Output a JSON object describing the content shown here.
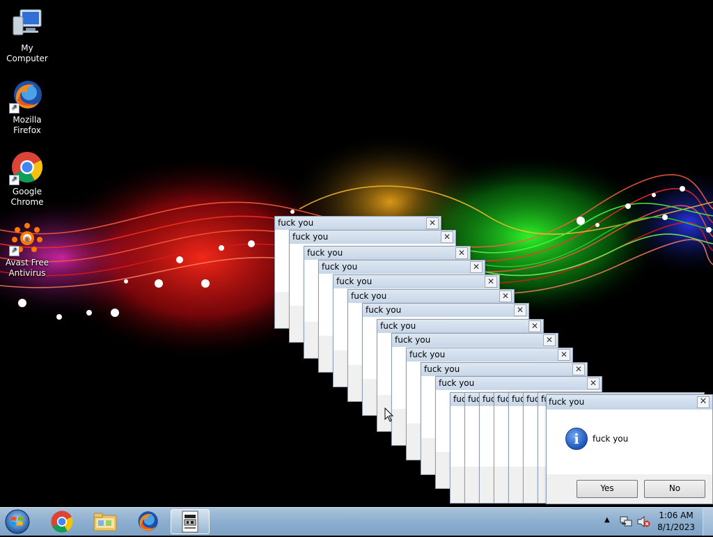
{
  "desktop_icons": [
    {
      "label": "My Computer",
      "icon": "computer-icon"
    },
    {
      "label": "Mozilla Firefox",
      "icon": "firefox-icon"
    },
    {
      "label": "Google Chrome",
      "icon": "chrome-icon"
    },
    {
      "label": "Avast Free Antivirus",
      "icon": "avast-icon"
    }
  ],
  "stack_dialog_title": "fuck you",
  "stack_dialog_short_title": "fuc",
  "message_box": {
    "title": "fuck you",
    "message": "fuck you",
    "icon": "info-icon",
    "yes_label": "Yes",
    "no_label": "No"
  },
  "taskbar": {
    "start_icon": "windows-start-icon",
    "pinned": [
      "chrome-icon",
      "file-explorer-icon",
      "firefox-icon",
      "script-app-icon"
    ],
    "active_index": 3,
    "clock": {
      "time": "1:06 AM",
      "date": "8/1/2023"
    },
    "tray_icons": [
      "show-hidden-icons-chevron",
      "network-icon",
      "volume-muted-icon"
    ]
  },
  "colors": {
    "taskbar": "#8fb0cf",
    "caption": "#c7d6e7",
    "info_blue": "#1b55b8"
  }
}
